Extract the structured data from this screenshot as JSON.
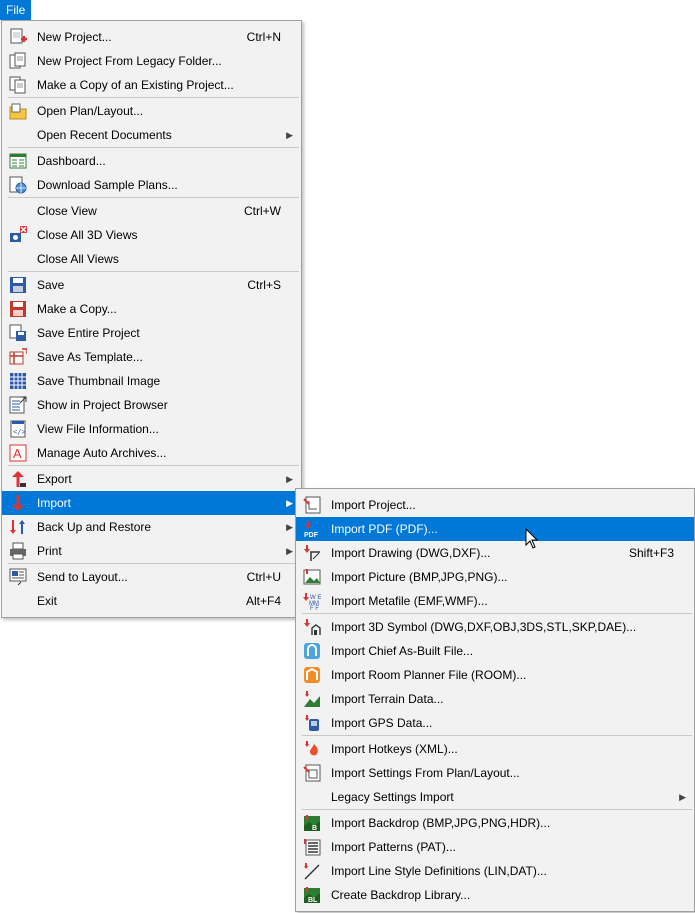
{
  "menubar": {
    "file_label": "File"
  },
  "file_menu": {
    "items": [
      {
        "type": "item",
        "label": "New Project...",
        "shortcut": "Ctrl+N",
        "icon": "new-project-icon"
      },
      {
        "type": "item",
        "label": "New Project From Legacy Folder...",
        "icon": "legacy-folder-icon"
      },
      {
        "type": "item",
        "label": "Make a Copy of an Existing Project...",
        "icon": "copy-project-icon"
      },
      {
        "type": "sep"
      },
      {
        "type": "item",
        "label": "Open Plan/Layout...",
        "icon": "open-folder-icon"
      },
      {
        "type": "item",
        "label": "Open Recent Documents",
        "submenu": true
      },
      {
        "type": "sep"
      },
      {
        "type": "item",
        "label": "Dashboard...",
        "icon": "dashboard-icon"
      },
      {
        "type": "item",
        "label": "Download Sample Plans...",
        "icon": "globe-icon"
      },
      {
        "type": "sep"
      },
      {
        "type": "item",
        "label": "Close View",
        "shortcut": "Ctrl+W"
      },
      {
        "type": "item",
        "label": "Close All 3D Views",
        "icon": "close-3d-icon"
      },
      {
        "type": "item",
        "label": "Close All Views"
      },
      {
        "type": "sep"
      },
      {
        "type": "item",
        "label": "Save",
        "shortcut": "Ctrl+S",
        "icon": "save-icon"
      },
      {
        "type": "item",
        "label": "Make a Copy...",
        "icon": "save-copy-icon"
      },
      {
        "type": "item",
        "label": "Save Entire Project",
        "icon": "save-project-icon"
      },
      {
        "type": "item",
        "label": "Save As Template...",
        "icon": "template-icon"
      },
      {
        "type": "item",
        "label": "Save Thumbnail Image",
        "icon": "thumbnail-grid-icon"
      },
      {
        "type": "item",
        "label": "Show in Project Browser",
        "icon": "project-browser-icon"
      },
      {
        "type": "item",
        "label": "View File Information...",
        "icon": "file-info-icon"
      },
      {
        "type": "item",
        "label": "Manage Auto Archives...",
        "icon": "archive-icon"
      },
      {
        "type": "sep"
      },
      {
        "type": "item",
        "label": "Export",
        "submenu": true,
        "icon": "export-icon"
      },
      {
        "type": "item",
        "label": "Import",
        "submenu": true,
        "icon": "import-icon",
        "highlight": true
      },
      {
        "type": "item",
        "label": "Back Up and Restore",
        "submenu": true,
        "icon": "backup-icon"
      },
      {
        "type": "item",
        "label": "Print",
        "submenu": true,
        "icon": "print-icon"
      },
      {
        "type": "sep"
      },
      {
        "type": "item",
        "label": "Send to Layout...",
        "shortcut": "Ctrl+U",
        "icon": "send-layout-icon"
      },
      {
        "type": "item",
        "label": "Exit",
        "shortcut": "Alt+F4"
      }
    ]
  },
  "import_menu": {
    "items": [
      {
        "type": "item",
        "label": "Import Project...",
        "icon": "import-project-icon"
      },
      {
        "type": "item",
        "label": "Import PDF (PDF)...",
        "icon": "import-pdf-icon",
        "hover": true
      },
      {
        "type": "item",
        "label": "Import Drawing (DWG,DXF)...",
        "shortcut": "Shift+F3",
        "icon": "import-drawing-icon"
      },
      {
        "type": "item",
        "label": "Import Picture (BMP,JPG,PNG)...",
        "icon": "import-picture-icon"
      },
      {
        "type": "item",
        "label": "Import Metafile (EMF,WMF)...",
        "icon": "import-metafile-icon"
      },
      {
        "type": "sep"
      },
      {
        "type": "item",
        "label": "Import 3D Symbol (DWG,DXF,OBJ,3DS,STL,SKP,DAE)...",
        "icon": "import-3d-symbol-icon"
      },
      {
        "type": "item",
        "label": "Import Chief As-Built File...",
        "icon": "as-built-icon"
      },
      {
        "type": "item",
        "label": "Import Room Planner File (ROOM)...",
        "icon": "room-planner-icon"
      },
      {
        "type": "item",
        "label": "Import Terrain Data...",
        "icon": "terrain-icon"
      },
      {
        "type": "item",
        "label": "Import GPS Data...",
        "icon": "gps-icon"
      },
      {
        "type": "sep"
      },
      {
        "type": "item",
        "label": "Import Hotkeys (XML)...",
        "icon": "hotkeys-icon"
      },
      {
        "type": "item",
        "label": "Import Settings From Plan/Layout...",
        "icon": "import-settings-icon"
      },
      {
        "type": "item",
        "label": "Legacy Settings Import",
        "submenu": true
      },
      {
        "type": "sep"
      },
      {
        "type": "item",
        "label": "Import Backdrop (BMP,JPG,PNG,HDR)...",
        "icon": "backdrop-icon"
      },
      {
        "type": "item",
        "label": "Import Patterns (PAT)...",
        "icon": "patterns-icon"
      },
      {
        "type": "item",
        "label": "Import Line Style Definitions (LIN,DAT)...",
        "icon": "line-style-icon"
      },
      {
        "type": "item",
        "label": "Create Backdrop Library...",
        "icon": "backdrop-library-icon"
      }
    ]
  }
}
